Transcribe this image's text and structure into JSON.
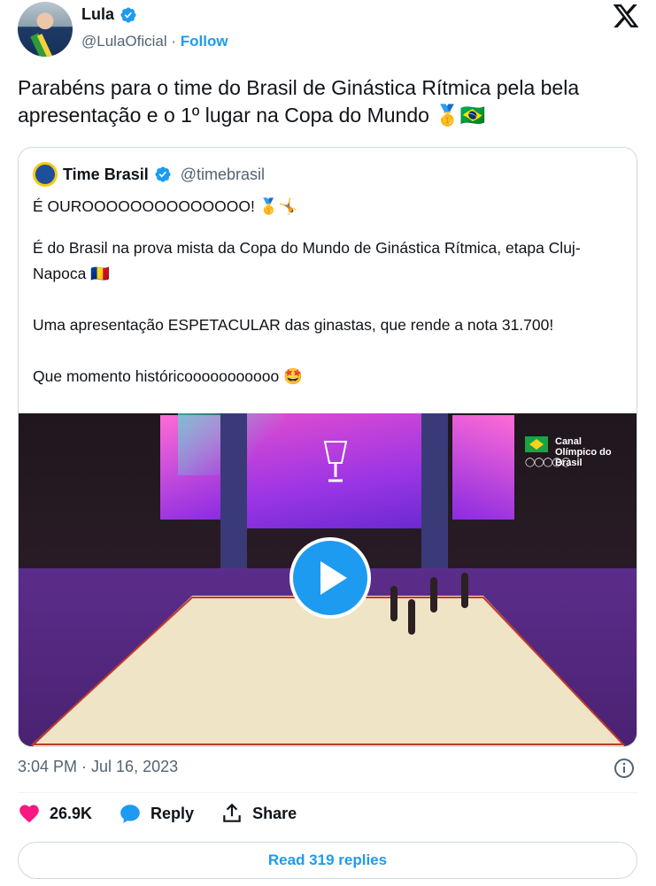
{
  "author": {
    "name": "Lula",
    "handle": "@LulaOficial",
    "separator": "·",
    "follow_label": "Follow",
    "verified_color": "#1d9bf0"
  },
  "tweet": {
    "text": "Parabéns para o time do Brasil de Ginástica Rítmica pela bela apresentação e o 1º lugar na Copa do Mundo 🥇🇧🇷"
  },
  "quote": {
    "name": "Time Brasil",
    "handle": "@timebrasil",
    "paragraphs": [
      "É OUROOOOOOOOOOOOOO! 🥇🤸",
      "É do Brasil na prova mista da Copa do Mundo de Ginástica Rítmica, etapa Cluj-Napoca 🇷🇴",
      "Uma apresentação ESPETACULAR das ginastas, que rende a nota 31.700!",
      "Que momento históricooooooooooo 🤩"
    ],
    "video": {
      "watermark": "Canal Olímpico do Brasil"
    }
  },
  "timestamp": "3:04 PM · Jul 16, 2023",
  "actions": {
    "likes": "26.9K",
    "reply_label": "Reply",
    "share_label": "Share"
  },
  "read_replies_label": "Read 319 replies",
  "colors": {
    "accent": "#1d9bf0",
    "like": "#f91880",
    "text": "#0f1419",
    "muted": "#536471"
  }
}
